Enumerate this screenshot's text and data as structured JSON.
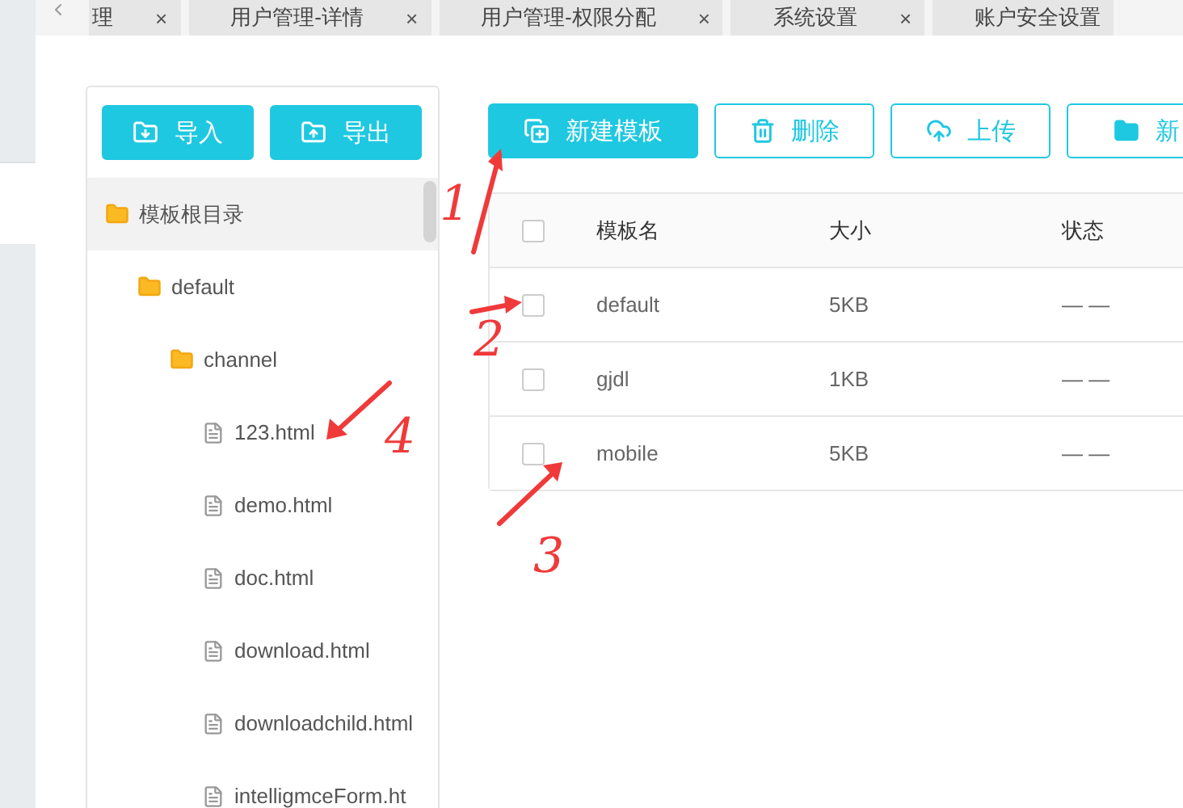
{
  "tabs": [
    {
      "label": "理",
      "selected": false
    },
    {
      "label": "用户管理-详情",
      "selected": false
    },
    {
      "label": "用户管理-权限分配",
      "selected": false
    },
    {
      "label": "系统设置",
      "selected": false
    },
    {
      "label": "账户安全设置",
      "selected": false
    }
  ],
  "close_mark": "×",
  "tree_actions": [
    {
      "label": "导入",
      "kind": "import"
    },
    {
      "label": "导出",
      "kind": "export"
    }
  ],
  "tree": [
    {
      "label": "模板根目录",
      "kind": "folder",
      "selected": true,
      "children": [
        {
          "label": "default",
          "kind": "folder",
          "selected": false,
          "children": [
            {
              "label": "channel",
              "kind": "folder",
              "selected": false,
              "children": [
                {
                  "label": "123.html",
                  "kind": "file",
                  "selected": false
                },
                {
                  "label": "demo.html",
                  "kind": "file",
                  "selected": false
                },
                {
                  "label": "doc.html",
                  "kind": "file",
                  "selected": false
                },
                {
                  "label": "download.html",
                  "kind": "file",
                  "selected": false
                },
                {
                  "label": "downloadchild.html",
                  "kind": "file",
                  "selected": false
                },
                {
                  "label": "intelligmceForm.ht",
                  "kind": "file",
                  "selected": false
                }
              ]
            }
          ]
        }
      ]
    }
  ],
  "toolbar": [
    {
      "label": "新建模板",
      "kind": "new",
      "filled": true
    },
    {
      "label": "删除",
      "kind": "delete",
      "filled": false
    },
    {
      "label": "上传",
      "kind": "upload",
      "filled": false
    },
    {
      "label": "新",
      "kind": "folder",
      "filled": false
    }
  ],
  "table": {
    "header_checked": false,
    "columns": [
      "模板名",
      "大小",
      "状态"
    ],
    "rows": [
      {
        "checked": false,
        "cells": [
          "default",
          "5KB",
          "— —"
        ]
      },
      {
        "checked": false,
        "cells": [
          "gjdl",
          "1KB",
          "— —"
        ]
      },
      {
        "checked": false,
        "cells": [
          "mobile",
          "5KB",
          "— —"
        ]
      }
    ]
  },
  "annotations": [
    "1",
    "2",
    "3",
    "4"
  ]
}
